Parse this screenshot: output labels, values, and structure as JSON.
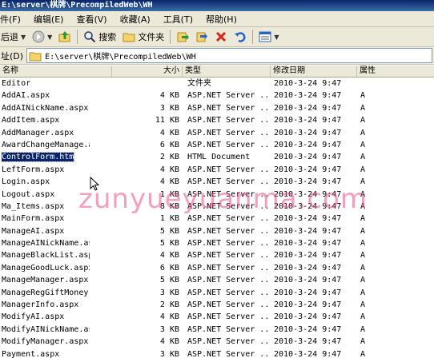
{
  "window": {
    "title": "E:\\server\\棋牌\\PrecompiledWeb\\WH"
  },
  "menu": [
    "件(F)",
    "编辑(E)",
    "查看(V)",
    "收藏(A)",
    "工具(T)",
    "帮助(H)"
  ],
  "toolbar": {
    "back_label": "后退",
    "search_label": "搜索",
    "folders_label": "文件夹"
  },
  "address": {
    "label": "址(D)",
    "value": "E:\\server\\棋牌\\PrecompiledWeb\\WH"
  },
  "columns": {
    "name": "名称",
    "size": "大小",
    "type": "类型",
    "modified": "修改日期",
    "attributes": "属性"
  },
  "files": [
    {
      "name": "Editor",
      "size": "",
      "type": "文件夹",
      "date": "2010-3-24 9:47",
      "attr": "",
      "selected": false
    },
    {
      "name": "AddAI.aspx",
      "size": "4 KB",
      "type": "ASP.NET Server ...",
      "date": "2010-3-24 9:47",
      "attr": "A",
      "selected": false
    },
    {
      "name": "AddAINickName.aspx",
      "size": "3 KB",
      "type": "ASP.NET Server ...",
      "date": "2010-3-24 9:47",
      "attr": "A",
      "selected": false
    },
    {
      "name": "AddItem.aspx",
      "size": "11 KB",
      "type": "ASP.NET Server ...",
      "date": "2010-3-24 9:47",
      "attr": "A",
      "selected": false
    },
    {
      "name": "AddManager.aspx",
      "size": "4 KB",
      "type": "ASP.NET Server ...",
      "date": "2010-3-24 9:47",
      "attr": "A",
      "selected": false
    },
    {
      "name": "AwardChangeManage.aspx",
      "size": "6 KB",
      "type": "ASP.NET Server ...",
      "date": "2010-3-24 9:47",
      "attr": "A",
      "selected": false
    },
    {
      "name": "ControlForm.htm",
      "size": "2 KB",
      "type": "HTML Document",
      "date": "2010-3-24 9:47",
      "attr": "A",
      "selected": true
    },
    {
      "name": "LeftForm.aspx",
      "size": "4 KB",
      "type": "ASP.NET Server ...",
      "date": "2010-3-24 9:47",
      "attr": "A",
      "selected": false
    },
    {
      "name": "Login.aspx",
      "size": "4 KB",
      "type": "ASP.NET Server ...",
      "date": "2010-3-24 9:47",
      "attr": "A",
      "selected": false
    },
    {
      "name": "Logout.aspx",
      "size": "1 KB",
      "type": "ASP.NET Server ...",
      "date": "2010-3-24 9:47",
      "attr": "A",
      "selected": false
    },
    {
      "name": "Ma_Items.aspx",
      "size": "8 KB",
      "type": "ASP.NET Server ...",
      "date": "2010-3-24 9:47",
      "attr": "A",
      "selected": false
    },
    {
      "name": "MainForm.aspx",
      "size": "1 KB",
      "type": "ASP.NET Server ...",
      "date": "2010-3-24 9:47",
      "attr": "A",
      "selected": false
    },
    {
      "name": "ManageAI.aspx",
      "size": "5 KB",
      "type": "ASP.NET Server ...",
      "date": "2010-3-24 9:47",
      "attr": "A",
      "selected": false
    },
    {
      "name": "ManageAINickName.aspx",
      "size": "5 KB",
      "type": "ASP.NET Server ...",
      "date": "2010-3-24 9:47",
      "attr": "A",
      "selected": false
    },
    {
      "name": "ManageBlackList.aspx",
      "size": "4 KB",
      "type": "ASP.NET Server ...",
      "date": "2010-3-24 9:47",
      "attr": "A",
      "selected": false
    },
    {
      "name": "ManageGoodLuck.aspx",
      "size": "6 KB",
      "type": "ASP.NET Server ...",
      "date": "2010-3-24 9:47",
      "attr": "A",
      "selected": false
    },
    {
      "name": "ManageManager.aspx",
      "size": "5 KB",
      "type": "ASP.NET Server ...",
      "date": "2010-3-24 9:47",
      "attr": "A",
      "selected": false
    },
    {
      "name": "ManageRegGiftMoney.aspx",
      "size": "3 KB",
      "type": "ASP.NET Server ...",
      "date": "2010-3-24 9:47",
      "attr": "A",
      "selected": false
    },
    {
      "name": "ManagerInfo.aspx",
      "size": "2 KB",
      "type": "ASP.NET Server ...",
      "date": "2010-3-24 9:47",
      "attr": "A",
      "selected": false
    },
    {
      "name": "ModifyAI.aspx",
      "size": "4 KB",
      "type": "ASP.NET Server ...",
      "date": "2010-3-24 9:47",
      "attr": "A",
      "selected": false
    },
    {
      "name": "ModifyAINickName.aspx",
      "size": "3 KB",
      "type": "ASP.NET Server ...",
      "date": "2010-3-24 9:47",
      "attr": "A",
      "selected": false
    },
    {
      "name": "ModifyManager.aspx",
      "size": "4 KB",
      "type": "ASP.NET Server ...",
      "date": "2010-3-24 9:47",
      "attr": "A",
      "selected": false
    },
    {
      "name": "Payment.aspx",
      "size": "3 KB",
      "type": "ASP.NET Server ...",
      "date": "2010-3-24 9:47",
      "attr": "A",
      "selected": false
    }
  ],
  "watermark": "zunyueyuanma.com",
  "colors": {
    "selection": "#0a246a",
    "chrome": "#ece9d8",
    "watermark": "#e8508c"
  },
  "icons": [
    "back-icon",
    "forward-icon",
    "up-folder-icon",
    "search-icon",
    "folders-icon",
    "move-to-icon",
    "copy-to-icon",
    "delete-icon",
    "undo-icon",
    "views-icon",
    "folder-icon"
  ]
}
